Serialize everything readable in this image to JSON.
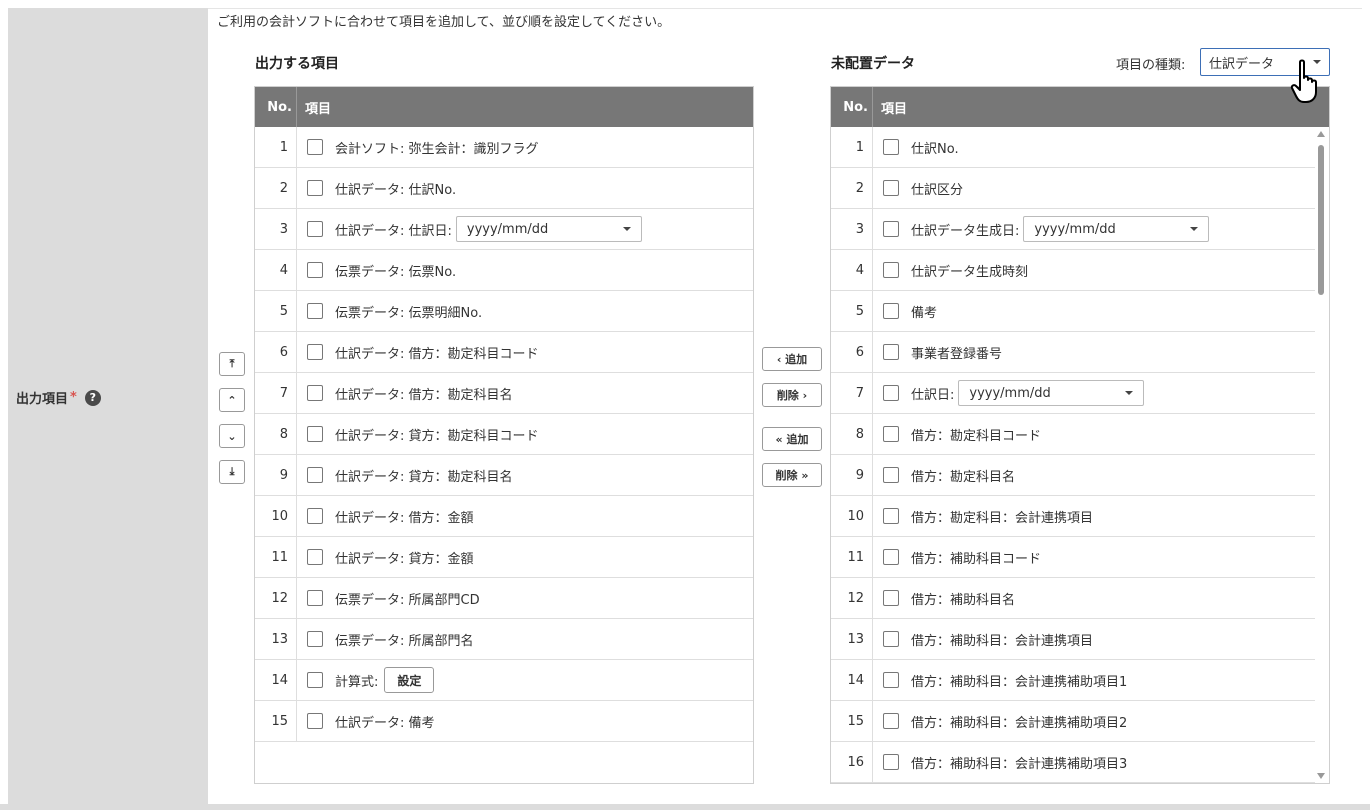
{
  "field": {
    "label": "出力項目",
    "required_mark": "*",
    "help": "?"
  },
  "instruction": "ご利用の会計ソフトに合わせて項目を追加して、並び順を設定してください。",
  "output": {
    "title": "出力する項目",
    "col_no": "No.",
    "col_item": "項目",
    "rows": [
      {
        "no": "1",
        "label": "会計ソフト: 弥生会計：識別フラグ"
      },
      {
        "no": "2",
        "label": "仕訳データ: 仕訳No."
      },
      {
        "no": "3",
        "label": "仕訳データ: 仕訳日:",
        "select": "yyyy/mm/dd"
      },
      {
        "no": "4",
        "label": "伝票データ: 伝票No."
      },
      {
        "no": "5",
        "label": "伝票データ: 伝票明細No."
      },
      {
        "no": "6",
        "label": "仕訳データ: 借方：勘定科目コード"
      },
      {
        "no": "7",
        "label": "仕訳データ: 借方：勘定科目名"
      },
      {
        "no": "8",
        "label": "仕訳データ: 貸方：勘定科目コード"
      },
      {
        "no": "9",
        "label": "仕訳データ: 貸方：勘定科目名"
      },
      {
        "no": "10",
        "label": "仕訳データ: 借方：金額"
      },
      {
        "no": "11",
        "label": "仕訳データ: 貸方：金額"
      },
      {
        "no": "12",
        "label": "伝票データ: 所属部門CD"
      },
      {
        "no": "13",
        "label": "伝票データ: 所属部門名"
      },
      {
        "no": "14",
        "label": "計算式:",
        "button": "設定"
      },
      {
        "no": "15",
        "label": "仕訳データ: 備考"
      }
    ]
  },
  "order_buttons": {
    "top": "⤒",
    "up": "⌃",
    "down": "⌄",
    "bottom": "⤓"
  },
  "move_buttons": {
    "add": "‹ 追加",
    "remove": "削除 ›",
    "add_all": "« 追加",
    "remove_all": "削除 »"
  },
  "unassigned": {
    "title": "未配置データ",
    "type_label": "項目の種類:",
    "type_value": "仕訳データ",
    "col_no": "No.",
    "col_item": "項目",
    "rows": [
      {
        "no": "1",
        "label": "仕訳No."
      },
      {
        "no": "2",
        "label": "仕訳区分"
      },
      {
        "no": "3",
        "label": "仕訳データ生成日:",
        "select": "yyyy/mm/dd"
      },
      {
        "no": "4",
        "label": "仕訳データ生成時刻"
      },
      {
        "no": "5",
        "label": "備考"
      },
      {
        "no": "6",
        "label": "事業者登録番号"
      },
      {
        "no": "7",
        "label": "仕訳日:",
        "select": "yyyy/mm/dd"
      },
      {
        "no": "8",
        "label": "借方：勘定科目コード"
      },
      {
        "no": "9",
        "label": "借方：勘定科目名"
      },
      {
        "no": "10",
        "label": "借方：勘定科目：会計連携項目"
      },
      {
        "no": "11",
        "label": "借方：補助科目コード"
      },
      {
        "no": "12",
        "label": "借方：補助科目名"
      },
      {
        "no": "13",
        "label": "借方：補助科目：会計連携項目"
      },
      {
        "no": "14",
        "label": "借方：補助科目：会計連携補助項目1"
      },
      {
        "no": "15",
        "label": "借方：補助科目：会計連携補助項目2"
      },
      {
        "no": "16",
        "label": "借方：補助科目：会計連携補助項目3"
      }
    ]
  }
}
